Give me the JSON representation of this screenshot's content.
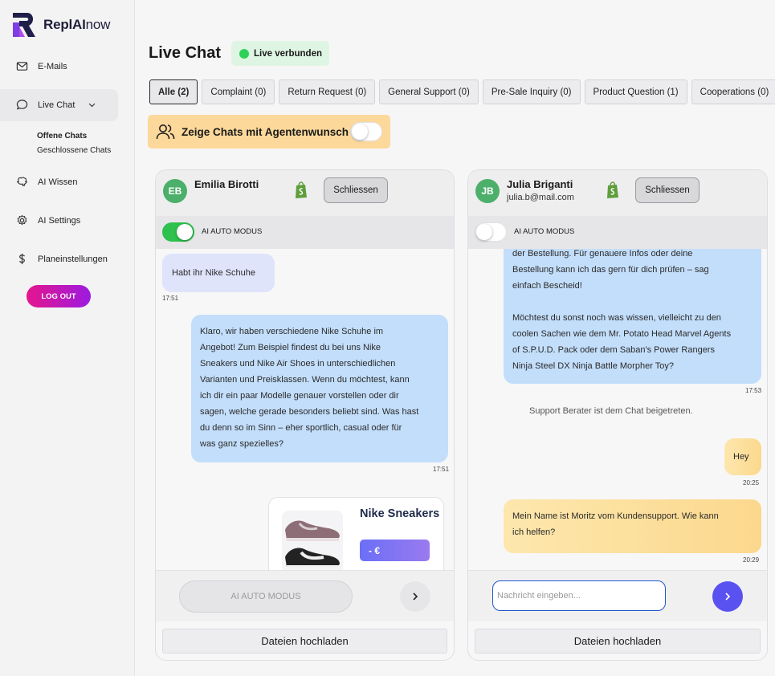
{
  "brand": {
    "name_regular": "ReplAI",
    "name_suffix": "now"
  },
  "sidebar": {
    "items": [
      {
        "label": "E-Mails",
        "icon": "mail-icon"
      },
      {
        "label": "Live Chat",
        "icon": "chat-bubble-icon"
      },
      {
        "label": "AI Wissen",
        "icon": "brain-icon"
      },
      {
        "label": "AI Settings",
        "icon": "gear-icon"
      },
      {
        "label": "Planeinstellungen",
        "icon": "dollar-icon"
      }
    ],
    "sub_items": [
      "Offene Chats",
      "Geschlossene Chats"
    ],
    "logout": "LOG OUT"
  },
  "header": {
    "title": "Live Chat",
    "status": "Live verbunden"
  },
  "tabs": [
    "Alle (2)",
    "Complaint (0)",
    "Return Request (0)",
    "General Support (0)",
    "Pre-Sale Inquiry (0)",
    "Product Question (1)",
    "Cooperations (0)"
  ],
  "agent_filter": {
    "label": "Zeige Chats mit Agentenwunsch",
    "enabled": false
  },
  "chats": [
    {
      "initials": "EB",
      "name": "Emilia Birotti",
      "close_label": "Schliessen",
      "ai_mode_label": "AI AUTO MODUS",
      "ai_mode_on": true,
      "messages": {
        "m1": "Habt ihr Nike Schuhe",
        "t1": "17:51",
        "m2": [
          "Klaro, wir haben verschiedene Nike Schuhe im",
          "Angebot! Zum Beispiel findest du bei uns Nike",
          "Sneakers und Nike Air Shoes in unterschiedlichen",
          "Varianten und Preisklassen. Wenn du möchtest, kann",
          "ich dir ein paar Modelle genauer vorstellen oder dir",
          "sagen, welche gerade besonders beliebt sind. Was hast",
          "du denn so im Sinn – eher sportlich, casual oder für",
          "was ganz spezielles?"
        ],
        "t2": "17:51",
        "product_name": "Nike Sneakers",
        "product_price": "- €"
      },
      "composer_placeholder": "AI AUTO MODUS",
      "upload_label": "Dateien hochladen"
    },
    {
      "initials": "JB",
      "name": "Julia Briganti",
      "email": "julia.b@mail.com",
      "close_label": "Schliessen",
      "ai_mode_label": "AI AUTO MODUS",
      "ai_mode_on": false,
      "messages": {
        "m1": [
          "der Bestellung. Für genauere Infos oder deine",
          "Bestellung kann ich das gern für dich prüfen – sag",
          "einfach Bescheid!",
          "",
          "Möchtest du sonst noch was wissen, vielleicht zu den",
          "coolen Sachen wie dem Mr. Potato Head Marvel Agents",
          "of S.P.U.D. Pack oder dem Saban's Power Rangers",
          "Ninja Steel DX Ninja Battle Morpher Toy?"
        ],
        "t1": "17:53",
        "system": "Support Berater ist dem Chat beigetreten.",
        "m2": "Hey",
        "t2": "20:25",
        "m3": [
          "Mein Name ist Moritz vom Kundensupport. Wie kann",
          "ich helfen?"
        ],
        "t3": "20:29"
      },
      "composer_placeholder": "Nachricht eingeben...",
      "upload_label": "Dateien hochladen"
    }
  ],
  "colors": {
    "accent": "#5a52f0",
    "live_green": "#2ed158",
    "agent_orange": "#fcd89a",
    "logout_pink": "#e5158d"
  }
}
